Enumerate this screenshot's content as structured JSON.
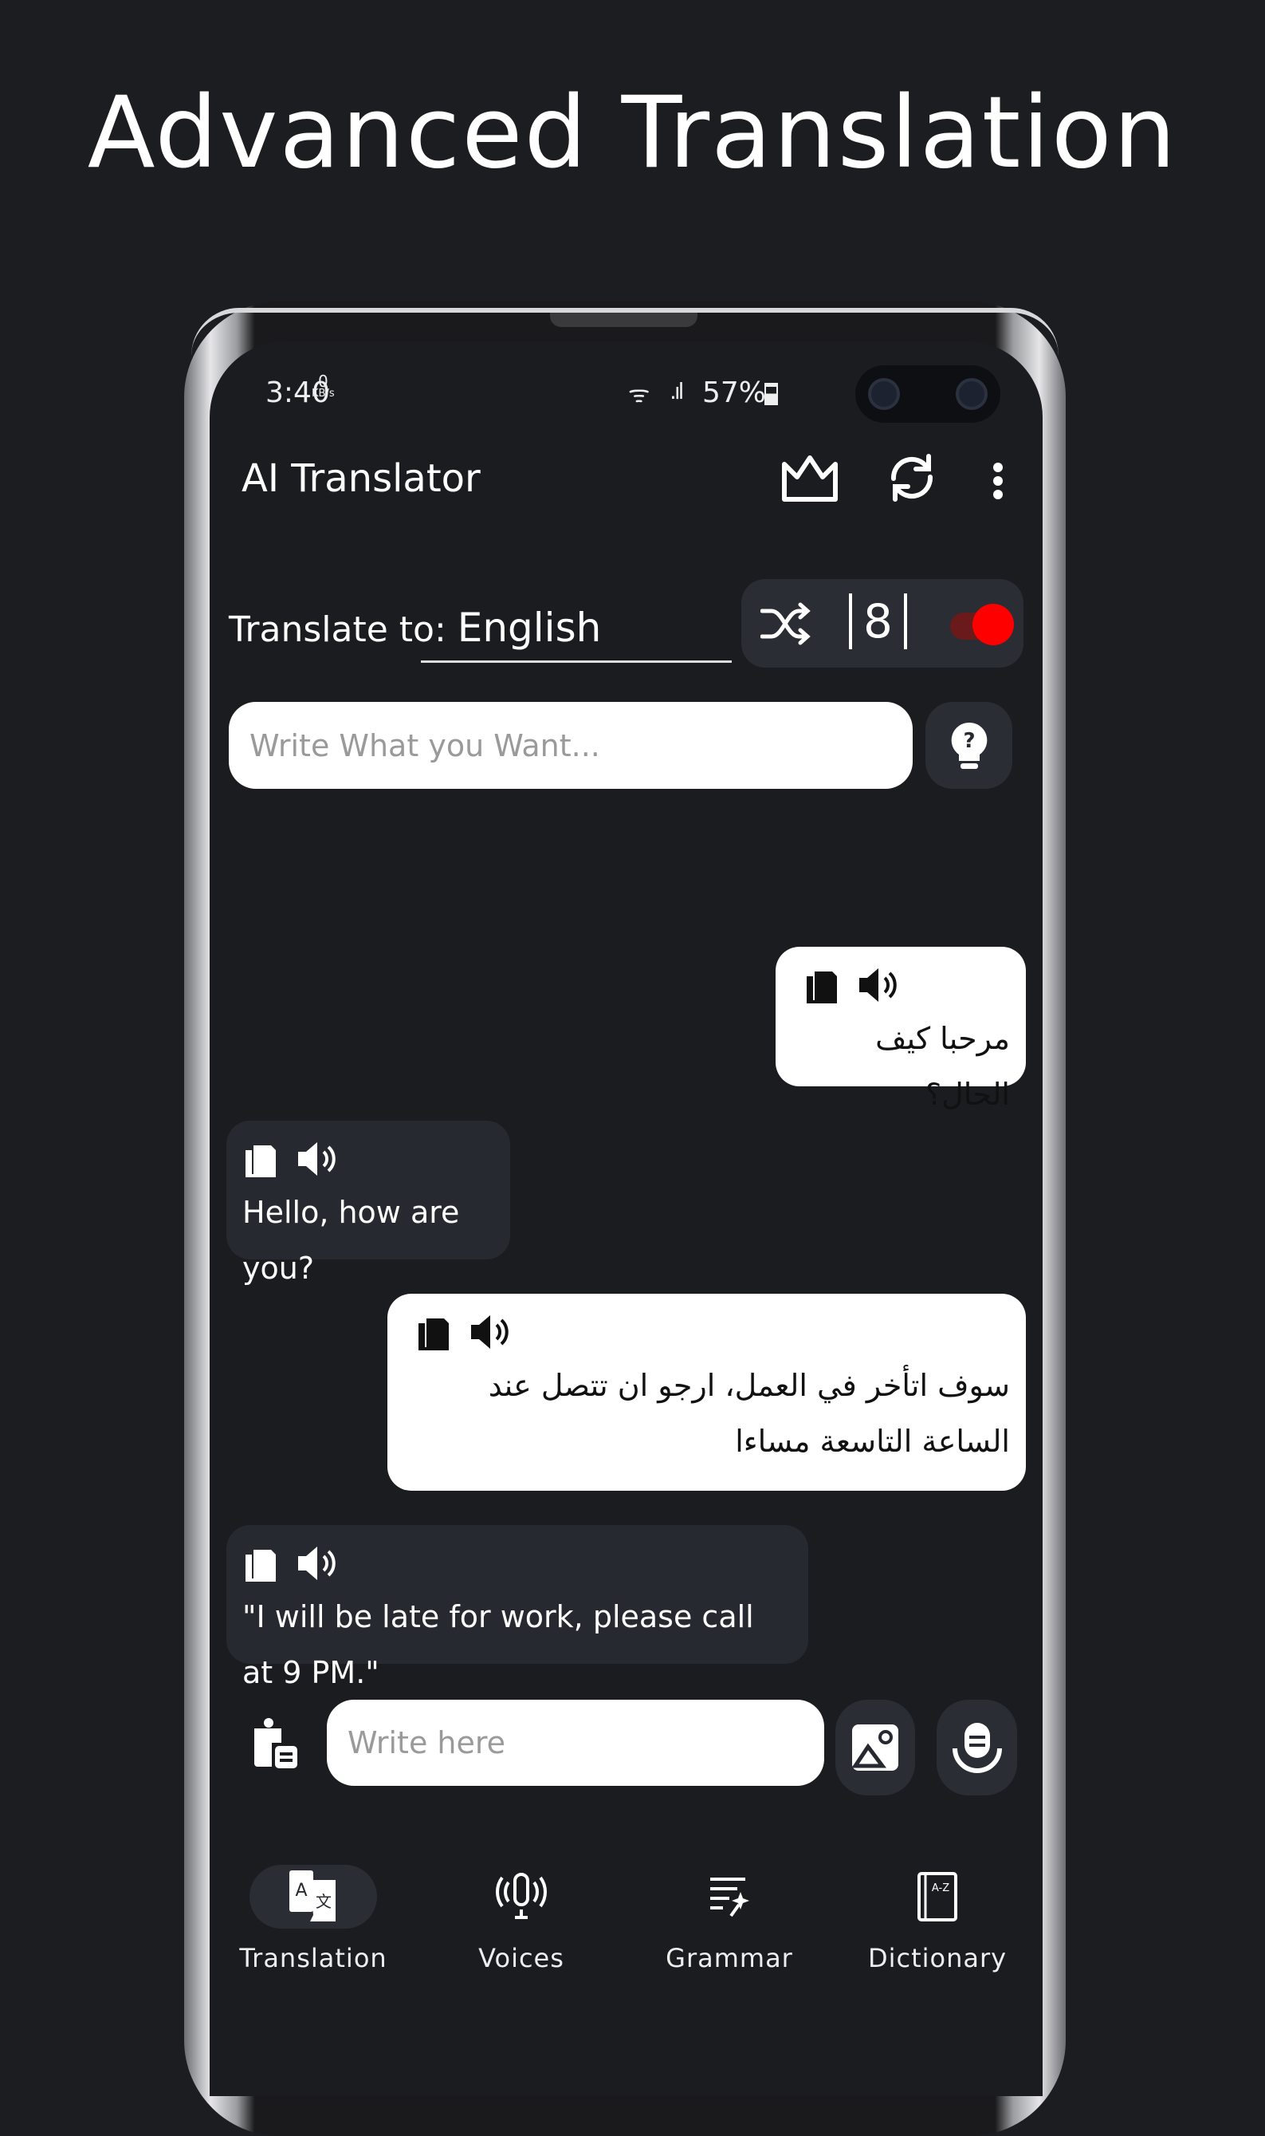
{
  "headline": "Advanced Translation",
  "status_bar": {
    "time": "3:40",
    "net_speed": "0",
    "net_unit": "KB/s",
    "battery": "57%"
  },
  "app_bar": {
    "title": "AI Translator",
    "icons": [
      "crown-icon",
      "refresh-icon",
      "more-vert-icon"
    ]
  },
  "translate": {
    "label": "Translate to:",
    "language": "English",
    "counter": "8",
    "toggle_on": true,
    "accent": "#ff0000"
  },
  "prompt_input": {
    "placeholder": "Write What you Want..."
  },
  "messages": [
    {
      "side": "right",
      "text": "مرحبا كيف الحال؟"
    },
    {
      "side": "left",
      "text": "Hello, how are you?"
    },
    {
      "side": "right",
      "text": "سوف اتأخر في العمل، ارجو ان تتصل عند الساعة التاسعة مساءا"
    },
    {
      "side": "left",
      "text": "\"I will be late for work, please call at 9 PM.\""
    }
  ],
  "composer": {
    "placeholder": "Write here"
  },
  "nav": [
    {
      "label": "Translation",
      "active": true
    },
    {
      "label": "Voices"
    },
    {
      "label": "Grammar"
    },
    {
      "label": "Dictionary"
    }
  ]
}
